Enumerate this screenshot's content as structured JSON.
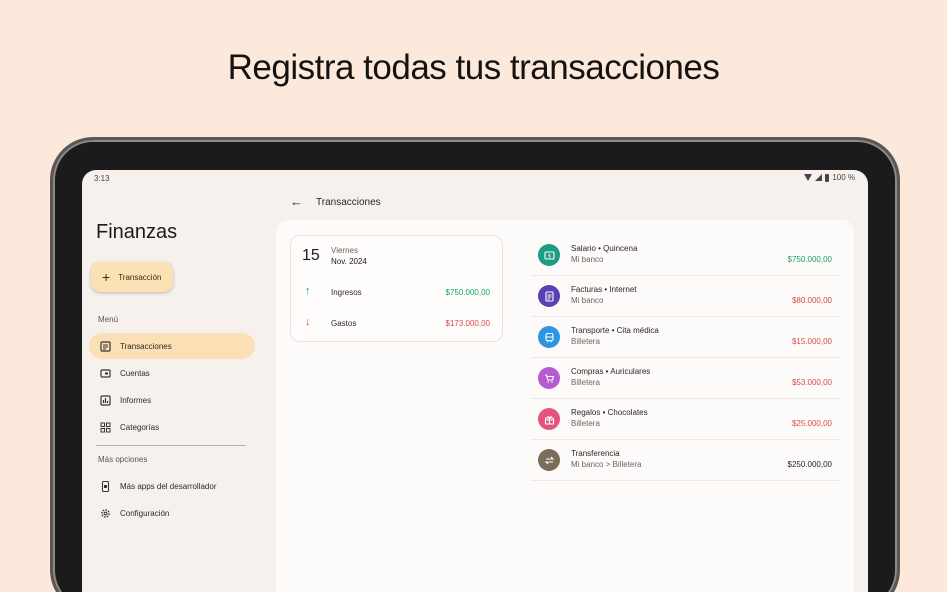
{
  "headline": "Registra todas tus transacciones",
  "status_bar": {
    "time": "3:13",
    "battery": "100 %"
  },
  "sidebar": {
    "app_title": "Finanzas",
    "fab_label": "Transacción",
    "menu_label": "Menú",
    "items": [
      {
        "label": "Transacciones",
        "icon": "receipt-icon",
        "active": true
      },
      {
        "label": "Cuentas",
        "icon": "wallet-icon",
        "active": false
      },
      {
        "label": "Informes",
        "icon": "bar-chart-icon",
        "active": false
      },
      {
        "label": "Categorías",
        "icon": "grid-icon",
        "active": false
      }
    ],
    "more_label": "Más opciones",
    "more_items": [
      {
        "label": "Más apps del desarrollador",
        "icon": "phone-app-icon"
      },
      {
        "label": "Configuración",
        "icon": "gear-icon"
      }
    ]
  },
  "main": {
    "title": "Transacciones",
    "summary": {
      "day": "15",
      "weekday": "Viernes",
      "month_year": "Nov. 2024",
      "income_label": "Ingresos",
      "income_amount": "$750.000,00",
      "expense_label": "Gastos",
      "expense_amount": "$173.000,00"
    },
    "transactions": [
      {
        "name": "Salario • Quincena",
        "account": "Mi banco",
        "amount": "$750.000,00",
        "type": "income",
        "icon": "money-icon",
        "color": "#1e9b83"
      },
      {
        "name": "Facturas • Internet",
        "account": "Mi banco",
        "amount": "$80.000,00",
        "type": "expense",
        "icon": "invoice-icon",
        "color": "#5b3fb4"
      },
      {
        "name": "Transporte • Cita médica",
        "account": "Billetera",
        "amount": "$15.000,00",
        "type": "expense",
        "icon": "bus-icon",
        "color": "#2d95e3"
      },
      {
        "name": "Compras • Auriculares",
        "account": "Billetera",
        "amount": "$53.000,00",
        "type": "expense",
        "icon": "cart-icon",
        "color": "#b45bd0"
      },
      {
        "name": "Regalos • Chocolates",
        "account": "Billetera",
        "amount": "$25.000,00",
        "type": "expense",
        "icon": "gift-icon",
        "color": "#e4547e"
      },
      {
        "name": "Transferencia",
        "account": "Mi banco > Billetera",
        "amount": "$250.000,00",
        "type": "transfer",
        "icon": "transfer-icon",
        "color": "#7b6d59"
      }
    ]
  }
}
